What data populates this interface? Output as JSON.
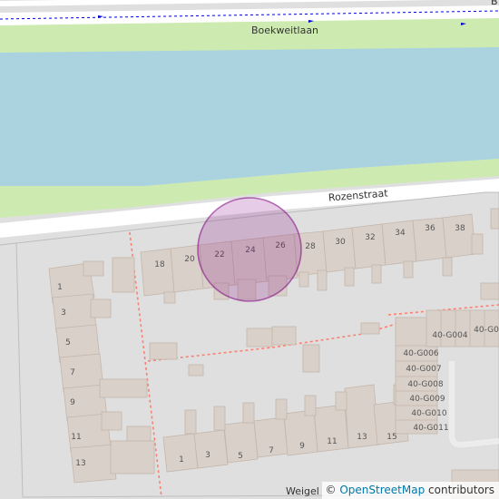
{
  "map": {
    "streets": {
      "top": "Boekweitlaan",
      "middle": "Rozenstraat",
      "bottom": "Weigel",
      "corner": "B"
    },
    "house_numbers": {
      "rozenstraat": [
        "18",
        "20",
        "22",
        "24",
        "26",
        "28",
        "30",
        "32",
        "34",
        "36",
        "38"
      ],
      "left_column": [
        "1",
        "3",
        "5",
        "7",
        "9",
        "11",
        "13"
      ],
      "bottom_row": [
        "1",
        "3",
        "5",
        "7",
        "9",
        "11",
        "13",
        "15"
      ],
      "garages": [
        "40-G006",
        "40-G007",
        "40-G008",
        "40-G009",
        "40-G010",
        "40-G011",
        "40-G004",
        "40-G0"
      ]
    },
    "colors": {
      "background": "#e0dfdf",
      "water": "#aad3df",
      "grass": "#cdebb0",
      "building": "#d9d0c9",
      "road": "#ffffff",
      "footway": "#fa8072",
      "highlight": "#800080"
    }
  },
  "attribution": {
    "copyright": "©",
    "link": "OpenStreetMap",
    "suffix": " contributors"
  }
}
